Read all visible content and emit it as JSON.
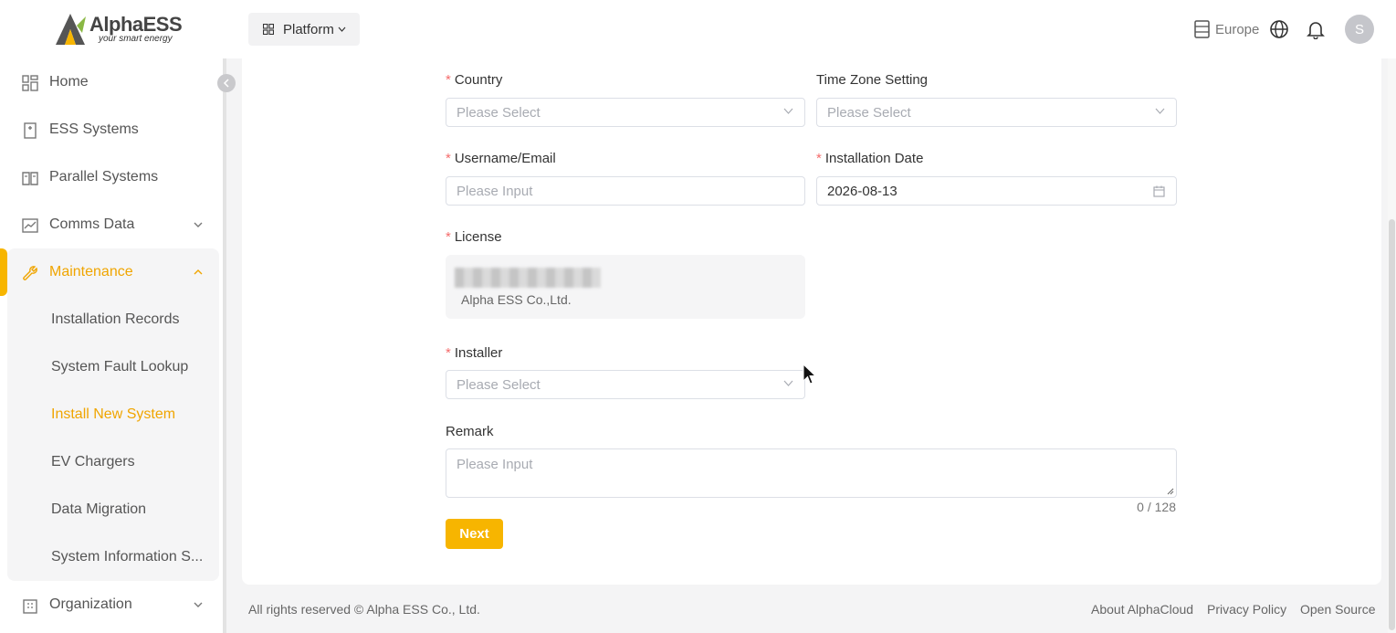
{
  "brand": {
    "name": "AlphaESS",
    "tagline": "your smart energy",
    "accent": "#f7b500"
  },
  "header": {
    "platform_label": "Platform",
    "region_label": "Europe",
    "avatar_initial": "S"
  },
  "sidebar": {
    "items": [
      {
        "label": "Home",
        "icon": "dashboard-grid-icon"
      },
      {
        "label": "ESS Systems",
        "icon": "battery-icon"
      },
      {
        "label": "Parallel Systems",
        "icon": "book-icon"
      },
      {
        "label": "Comms Data",
        "icon": "chart-icon"
      },
      {
        "label": "Maintenance",
        "icon": "wrench-icon"
      },
      {
        "label": "Organization",
        "icon": "building-icon"
      }
    ],
    "maintenance_sub": [
      {
        "label": "Installation Records"
      },
      {
        "label": "System Fault Lookup"
      },
      {
        "label": "Install New System",
        "active": true
      },
      {
        "label": "EV Chargers"
      },
      {
        "label": "Data Migration"
      },
      {
        "label": "System Information S..."
      }
    ]
  },
  "form": {
    "country": {
      "label": "Country",
      "placeholder": "Please Select",
      "required": true
    },
    "timezone": {
      "label": "Time Zone Setting",
      "placeholder": "Please Select",
      "required": false
    },
    "username": {
      "label": "Username/Email",
      "placeholder": "Please Input",
      "required": true
    },
    "install_date": {
      "label": "Installation Date",
      "value": "2026-08-13",
      "required": true
    },
    "license": {
      "label": "License",
      "company": "Alpha ESS Co.,Ltd.",
      "required": true
    },
    "installer": {
      "label": "Installer",
      "placeholder": "Please Select",
      "required": true
    },
    "remark": {
      "label": "Remark",
      "placeholder": "Please Input",
      "counter": "0 / 128"
    },
    "next_label": "Next",
    "required_mark": "*"
  },
  "footer": {
    "copyright": "All rights reserved © Alpha ESS Co., Ltd.",
    "links": [
      "About AlphaCloud",
      "Privacy Policy",
      "Open Source"
    ]
  }
}
